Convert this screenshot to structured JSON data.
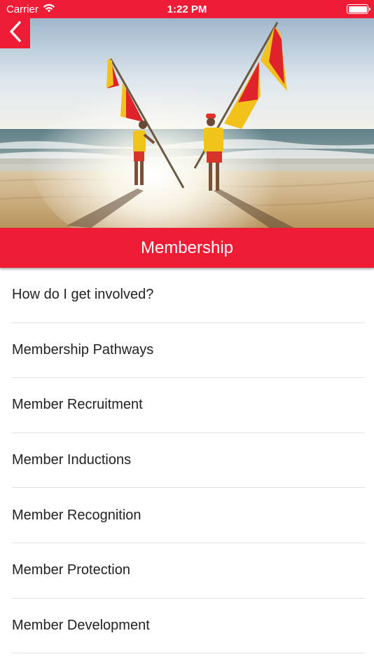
{
  "status_bar": {
    "carrier": "Carrier",
    "time": "1:22 PM",
    "wifi_icon": "wifi-icon",
    "battery_icon": "battery-full-icon"
  },
  "colors": {
    "brand_red": "#ee1c34",
    "text": "#222222",
    "divider": "#e2e2e2"
  },
  "back_button": {
    "icon": "chevron-left-icon"
  },
  "header": {
    "title": "Membership"
  },
  "menu": {
    "items": [
      {
        "label": "How do I get involved?"
      },
      {
        "label": "Membership Pathways"
      },
      {
        "label": "Member Recruitment"
      },
      {
        "label": "Member Inductions"
      },
      {
        "label": "Member Recognition"
      },
      {
        "label": "Member Protection"
      },
      {
        "label": "Member Development"
      }
    ]
  }
}
